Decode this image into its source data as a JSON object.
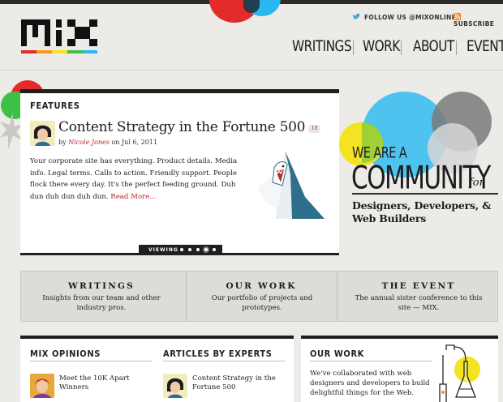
{
  "header": {
    "logo_text": "MIX",
    "follow_label": "FOLLOW US @MIXONLINE",
    "subscribe_label": "SUBSCRIBE",
    "nav": [
      "WRITINGS",
      "WORK",
      "ABOUT",
      "EVENT"
    ]
  },
  "featured": {
    "section_label": "FEATURES",
    "headline": "Content Strategy in the Fortune 500",
    "comment_count": "10",
    "byline_prefix": "by",
    "author": "Nicole Jones",
    "date": "on Jul 6, 2011",
    "excerpt": "Your corporate site has everything. Product details. Media info. Legal terms. Calls to action. Friendly support. People flock there every day. It's the perfect feeding ground. Duh dun duh dun duh dun.",
    "read_more": "Read More...",
    "viewing_label": "VIEWING",
    "pager_total": 5,
    "pager_active": 4
  },
  "community": {
    "line1": "WE ARE A",
    "line2": "COMMUNITY",
    "line2_suffix": "for",
    "line3": "Designers, Developers, & Web Builders"
  },
  "promos": [
    {
      "title": "WRITINGS",
      "desc": "Insights from our team and other industry pros."
    },
    {
      "title": "OUR WORK",
      "desc": "Our portfolio of projects and prototypes."
    },
    {
      "title": "THE EVENT",
      "desc": "The annual sister conference to this site — MIX."
    }
  ],
  "bottom": {
    "mix_opinions_label": "MIX OPINIONS",
    "mix_opinions_item": "Meet the 10K Apart Winners",
    "articles_label": "ARTICLES BY EXPERTS",
    "articles_item": "Content Strategy in the Fortune 500",
    "our_work_label": "OUR WORK",
    "our_work_text": "We've collaborated with web designers and developers to build delightful things for the Web."
  },
  "colors": {
    "accent_red": "#b1272d",
    "circle_red": "#e32b2b",
    "circle_blue": "#2ab6f0",
    "circle_yellow": "#f4e321",
    "circle_green": "#3ec046",
    "circle_gray": "#6e6e6e"
  }
}
